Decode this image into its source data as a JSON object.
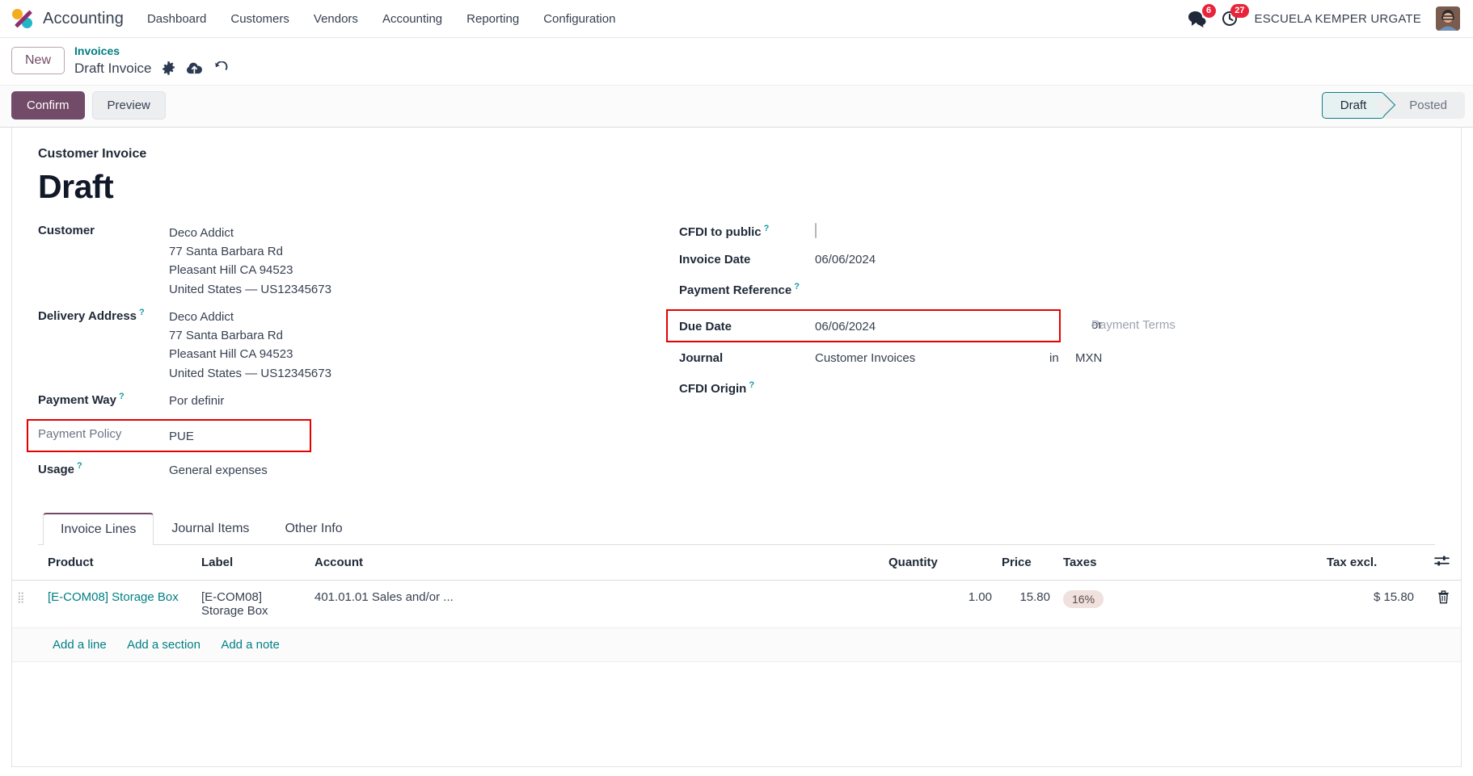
{
  "navbar": {
    "brand": "Accounting",
    "menu": [
      "Dashboard",
      "Customers",
      "Vendors",
      "Accounting",
      "Reporting",
      "Configuration"
    ],
    "messages_count": "6",
    "activities_count": "27",
    "username": "ESCUELA KEMPER URGATE"
  },
  "breadcrumb": {
    "new_button": "New",
    "parent": "Invoices",
    "current": "Draft Invoice",
    "icons": [
      "gear-icon",
      "cloud-upload-icon",
      "discard-icon"
    ]
  },
  "actionbar": {
    "confirm": "Confirm",
    "preview": "Preview",
    "status": [
      {
        "label": "Draft",
        "active": true
      },
      {
        "label": "Posted",
        "active": false
      }
    ]
  },
  "form": {
    "subtitle": "Customer Invoice",
    "title": "Draft",
    "left": [
      {
        "label": "Customer",
        "help": false,
        "lines": [
          "Deco Addict",
          "77 Santa Barbara Rd",
          "Pleasant Hill CA 94523",
          "United States — US12345673"
        ]
      },
      {
        "label": "Delivery Address",
        "help": true,
        "lines": [
          "Deco Addict",
          "77 Santa Barbara Rd",
          "Pleasant Hill CA 94523",
          "United States — US12345673"
        ]
      },
      {
        "label": "Payment Way",
        "help": true,
        "lines": [
          "Por definir"
        ]
      },
      {
        "label": "Payment Policy",
        "help": false,
        "muted": true,
        "highlight": true,
        "lines": [
          "PUE"
        ]
      },
      {
        "label": "Usage",
        "help": true,
        "lines": [
          "General expenses"
        ]
      }
    ],
    "right": [
      {
        "label": "CFDI to public",
        "help": true,
        "type": "checkbox",
        "checked": false
      },
      {
        "label": "Invoice Date",
        "help": false,
        "value": "06/06/2024"
      },
      {
        "label": "Payment Reference",
        "help": true,
        "value": ""
      },
      {
        "label": "Due Date",
        "help": false,
        "value": "06/06/2024",
        "highlight": true,
        "suffix_label": "or",
        "suffix_value": "Payment Terms"
      },
      {
        "label": "Journal",
        "help": false,
        "value": "Customer Invoices",
        "suffix_label": "in",
        "suffix_value": "MXN"
      },
      {
        "label": "CFDI Origin",
        "help": true,
        "value": ""
      }
    ]
  },
  "notebook": {
    "tabs": [
      {
        "label": "Invoice Lines",
        "active": true
      },
      {
        "label": "Journal Items",
        "active": false
      },
      {
        "label": "Other Info",
        "active": false
      }
    ],
    "columns": [
      "Product",
      "Label",
      "Account",
      "Quantity",
      "Price",
      "Taxes",
      "Tax excl."
    ],
    "optional_columns_icon": "sliders-icon",
    "rows": [
      {
        "product": "[E-COM08] Storage Box",
        "label": "[E-COM08] Storage Box",
        "account": "401.01.01 Sales and/or ...",
        "quantity": "1.00",
        "price": "15.80",
        "taxes": "16%",
        "tax_excl": "$ 15.80",
        "delete_icon": "trash-icon"
      }
    ],
    "add_links": [
      "Add a line",
      "Add a section",
      "Add a note"
    ]
  },
  "colors": {
    "accent_purple": "#714b67",
    "link_teal": "#017e84",
    "badge_red": "#e8243c",
    "highlight_red": "#e60000",
    "status_teal": "#137b7f"
  }
}
